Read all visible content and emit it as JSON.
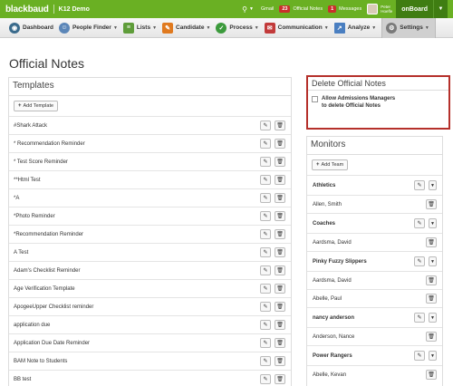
{
  "app": {
    "logo": "blackbaud",
    "product": "K12 Demo"
  },
  "topbar": {
    "search_icon": "search-icon",
    "gmail_label": "Gmail",
    "official_notes_count": "23",
    "official_notes_label": "Official Notes",
    "messages_count": "1",
    "messages_label": "Messages",
    "user_name_line1": "Peter",
    "user_name_line2": "Hoefle",
    "onboard_label": "onBoard"
  },
  "nav": {
    "items": [
      {
        "label": "Dashboard",
        "icon": "dashboard-icon",
        "color": "#3a6b8c"
      },
      {
        "label": "People Finder",
        "icon": "people-finder-icon",
        "color": "#5b86b8"
      },
      {
        "label": "Lists",
        "icon": "lists-icon",
        "color": "#5f9d3a"
      },
      {
        "label": "Candidate",
        "icon": "candidate-icon",
        "color": "#e07a1f"
      },
      {
        "label": "Process",
        "icon": "process-icon",
        "color": "#3b9a3b"
      },
      {
        "label": "Communication",
        "icon": "communication-icon",
        "color": "#c23a3a"
      },
      {
        "label": "Analyze",
        "icon": "analyze-icon",
        "color": "#4a7fc1"
      },
      {
        "label": "Settings",
        "icon": "settings-icon",
        "color": "#7a7a7a"
      }
    ]
  },
  "page": {
    "title": "Official Notes"
  },
  "templates": {
    "heading": "Templates",
    "add_label": "Add Template",
    "rows": [
      "#Shark Attack",
      "* Recommendation Reminder",
      "* Test Score Reminder",
      "**Html Test",
      "*A",
      "*Photo Reminder",
      "*Recommendation Reminder",
      "A Test",
      "Adam's Checklist Reminder",
      "Age Verification Template",
      "ApogeeUpper Checklist reminder",
      "application due",
      "Application Due Date Reminder",
      "BAM Note to Students",
      "BB test"
    ]
  },
  "delete_official_notes": {
    "heading": "Delete Official Notes",
    "checkbox_label_line1": "Allow Admissions Managers",
    "checkbox_label_line2": "to delete Official Notes"
  },
  "monitors": {
    "heading": "Monitors",
    "add_label": "Add Team",
    "teams": [
      {
        "name": "Athletics",
        "members": [
          "Allen, Smith"
        ]
      },
      {
        "name": "Coaches",
        "members": [
          "Aardsma, David"
        ]
      },
      {
        "name": "Pinky Fuzzy Slippers",
        "members": [
          "Aardsma, David",
          "Abelle, Paul"
        ]
      },
      {
        "name": "nancy anderson",
        "members": [
          "Anderson, Nance"
        ]
      },
      {
        "name": "Power Rangers",
        "members": [
          "Abelle, Kevan"
        ]
      }
    ]
  },
  "colors": {
    "brand_green": "#6ab023",
    "dark_green": "#3f7d12",
    "badge_red": "#c9302c",
    "highlight_border": "#b5302b"
  }
}
